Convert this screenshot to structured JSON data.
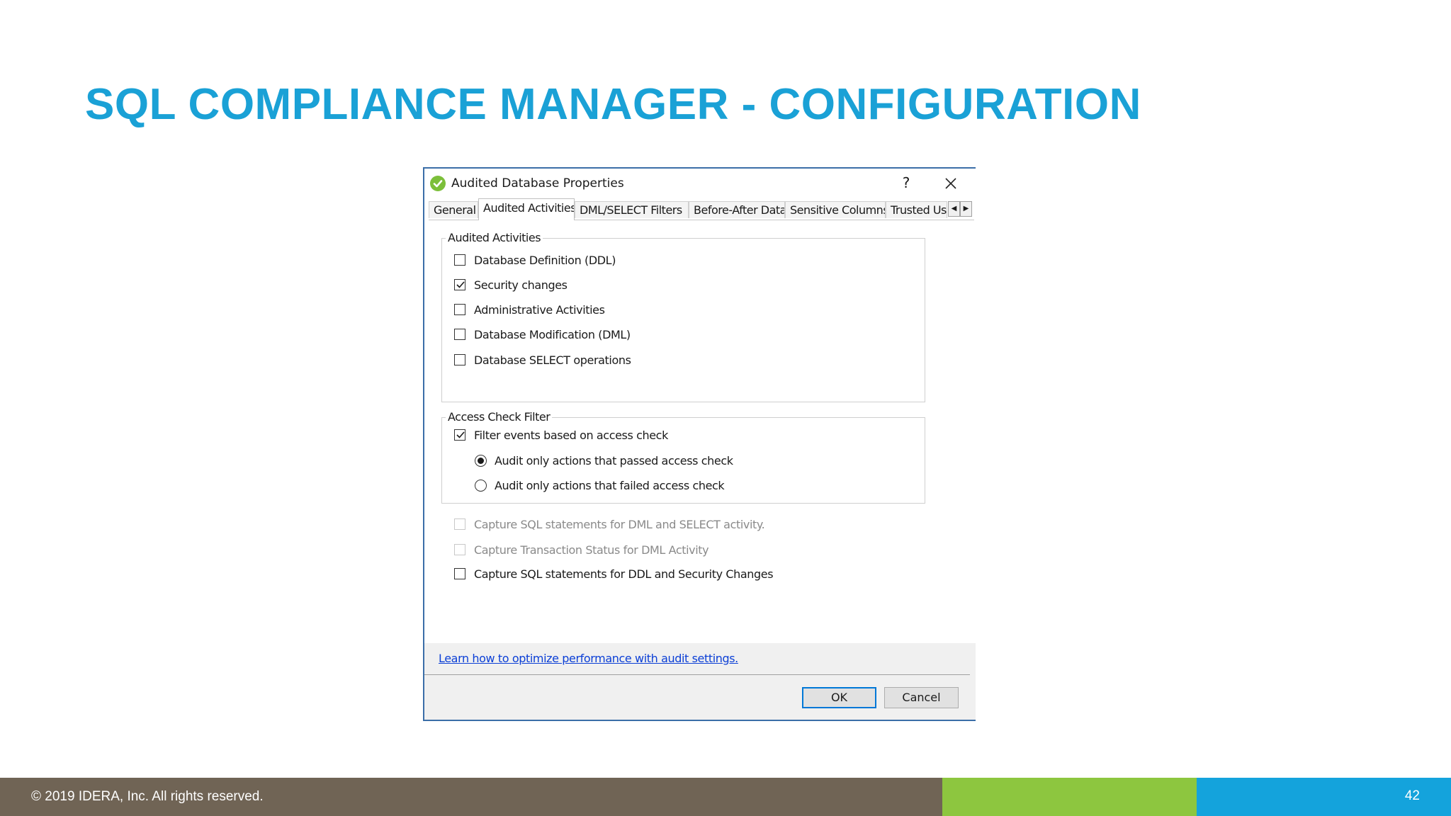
{
  "slide": {
    "title": "SQL COMPLIANCE MANAGER - CONFIGURATION",
    "copyright": "© 2019 IDERA, Inc. All rights reserved.",
    "page_number": "42"
  },
  "dialog": {
    "title": "Audited Database Properties",
    "help": "?",
    "tabs": [
      "General",
      "Audited Activities",
      "DML/SELECT Filters",
      "Before-After Data",
      "Sensitive Columns",
      "Trusted Us"
    ],
    "active_tab": "Audited Activities",
    "audited_activities": {
      "label": "Audited Activities",
      "items": [
        {
          "label": "Database Definition (DDL)",
          "checked": false
        },
        {
          "label": "Security changes",
          "checked": true
        },
        {
          "label": "Administrative Activities",
          "checked": false
        },
        {
          "label": "Database Modification (DML)",
          "checked": false
        },
        {
          "label": "Database SELECT operations",
          "checked": false
        }
      ]
    },
    "access_check": {
      "label": "Access Check Filter",
      "filter_label": "Filter events based on access check",
      "filter_checked": true,
      "radio_passed": "Audit only actions that passed access check",
      "radio_failed": "Audit only actions that failed access check",
      "selected": "passed"
    },
    "capture": [
      {
        "label": "Capture SQL statements for DML and SELECT activity.",
        "checked": false,
        "disabled": true
      },
      {
        "label": "Capture Transaction Status for DML Activity",
        "checked": false,
        "disabled": true
      },
      {
        "label": "Capture SQL statements for DDL and Security Changes",
        "checked": false,
        "disabled": false
      }
    ],
    "help_link": "Learn how to optimize performance with audit settings.",
    "ok_label": "OK",
    "cancel_label": "Cancel"
  },
  "colors": {
    "title": "#1aa1d6",
    "bar_brown": "#706455",
    "bar_green": "#8dc63f",
    "bar_blue": "#14a3dc"
  }
}
